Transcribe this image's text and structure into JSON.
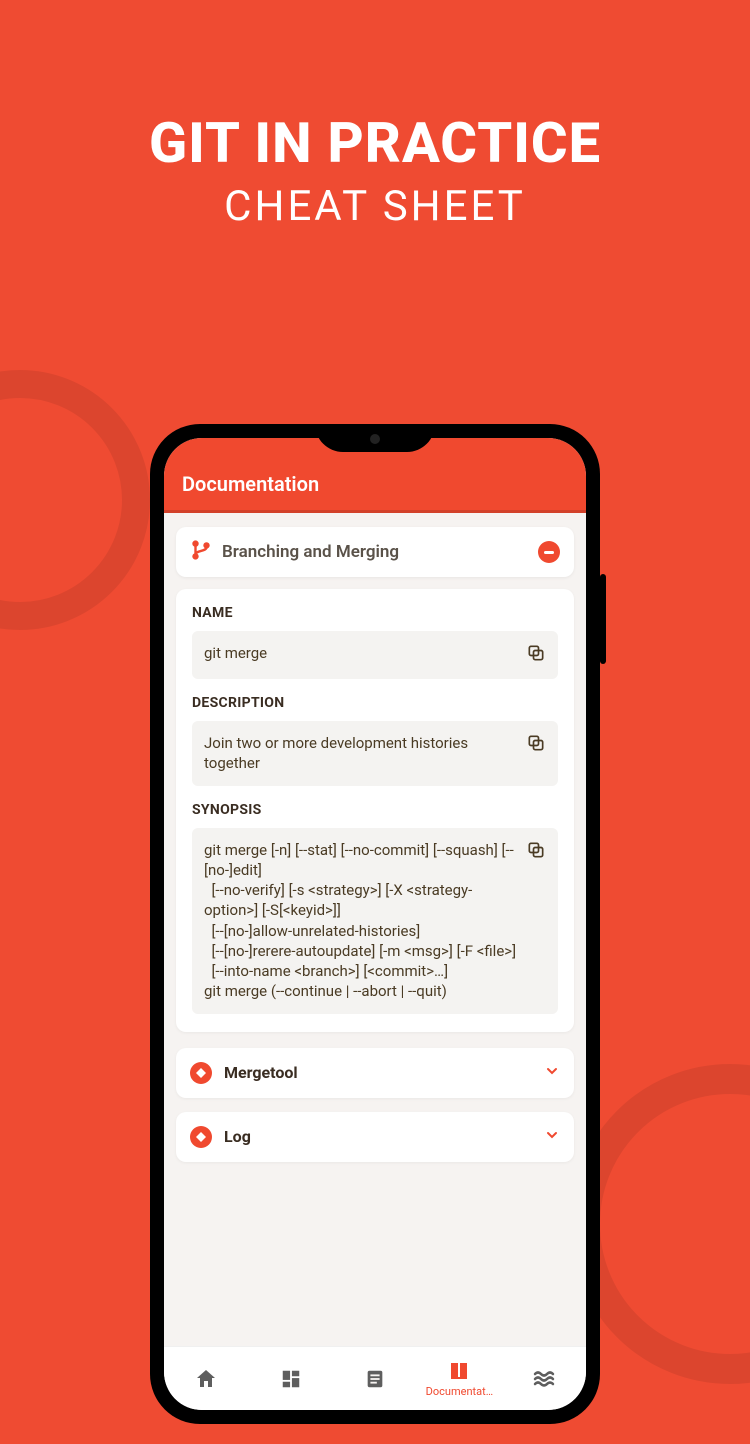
{
  "hero": {
    "title": "GIT IN PRACTICE",
    "subtitle": "CHEAT SHEET"
  },
  "appbar": {
    "title": "Documentation"
  },
  "section": {
    "title": "Branching and Merging"
  },
  "doc": {
    "name_label": "NAME",
    "name_value": "git merge",
    "desc_label": "DESCRIPTION",
    "desc_value": "Join two or more development histories together",
    "syn_label": "SYNOPSIS",
    "syn_value": "git merge [-n] [--stat] [--no-commit] [--squash] [--[no-]edit]\n  [--no-verify] [-s <strategy>] [-X <strategy-option>] [-S[<keyid>]]\n  [--[no-]allow-unrelated-histories]\n  [--[no-]rerere-autoupdate] [-m <msg>] [-F <file>]\n  [--into-name <branch>] [<commit>…]\ngit merge (--continue | --abort | --quit)"
  },
  "items": {
    "mergetool": "Mergetool",
    "log": "Log"
  },
  "nav": {
    "doc_label": "Documentat…"
  }
}
